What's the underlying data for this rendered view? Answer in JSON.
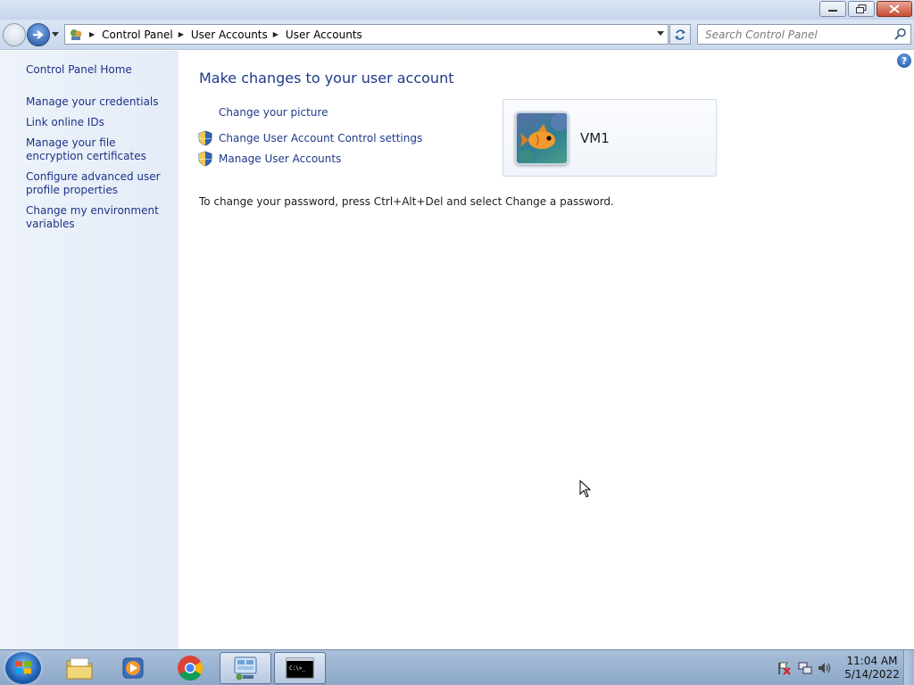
{
  "window": {
    "minimize_icon": "minimize-icon",
    "maximize_icon": "restore-icon",
    "close_icon": "close-icon"
  },
  "navigation": {
    "breadcrumbs": [
      "Control Panel",
      "User Accounts",
      "User Accounts"
    ],
    "search_placeholder": "Search Control Panel"
  },
  "sidebar": {
    "home": "Control Panel Home",
    "links": [
      {
        "label": "Manage your credentials"
      },
      {
        "label": "Link online IDs"
      },
      {
        "label": "Manage your file encryption certificates"
      },
      {
        "label": "Configure advanced user profile properties"
      },
      {
        "label": "Change my environment variables"
      }
    ]
  },
  "main": {
    "heading": "Make changes to your user account",
    "tasks": [
      {
        "label": "Change your picture",
        "shield": false
      },
      {
        "label": "Change User Account Control settings",
        "shield": true
      },
      {
        "label": "Manage User Accounts",
        "shield": true
      }
    ],
    "password_note": "To change your password, press Ctrl+Alt+Del and select Change a password.",
    "user": {
      "name": "VM1",
      "avatar_icon": "fish-picture"
    }
  },
  "taskbar": {
    "items": [
      {
        "name": "windows-explorer",
        "active": false
      },
      {
        "name": "windows-media-player",
        "active": false
      },
      {
        "name": "google-chrome",
        "active": false
      },
      {
        "name": "control-panel",
        "active": true
      },
      {
        "name": "command-prompt",
        "active": true
      }
    ],
    "clock_time": "11:04 AM",
    "clock_date": "5/14/2022"
  },
  "colors": {
    "link": "#1e3a8a",
    "sidebar_bg": "#e8eef8",
    "taskbar_bg": "#9fb6d3"
  }
}
